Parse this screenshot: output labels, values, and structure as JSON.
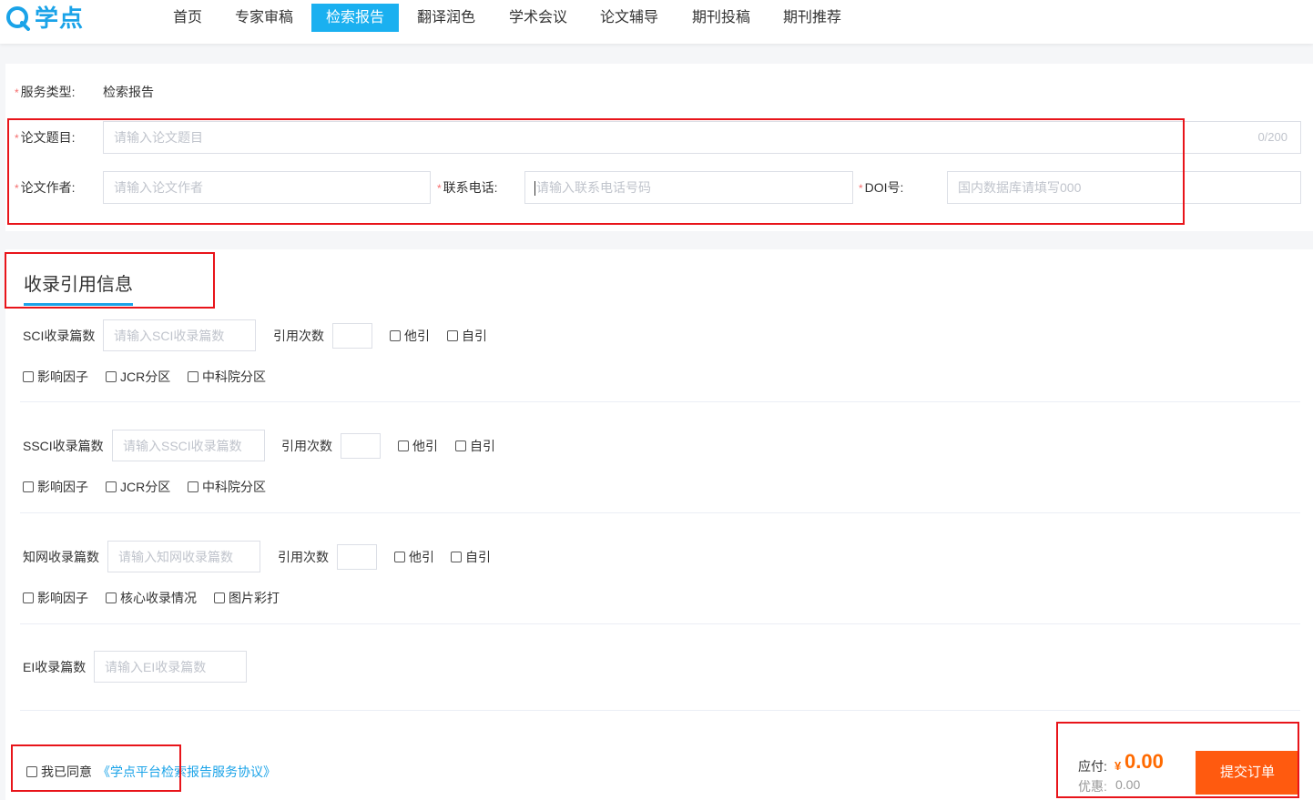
{
  "brand": {
    "name": "学点"
  },
  "nav": {
    "items": [
      {
        "label": "首页"
      },
      {
        "label": "专家审稿"
      },
      {
        "label": "检索报告"
      },
      {
        "label": "翻译润色"
      },
      {
        "label": "学术会议"
      },
      {
        "label": "论文辅导"
      },
      {
        "label": "期刊投稿"
      },
      {
        "label": "期刊推荐"
      }
    ],
    "active_index": 2
  },
  "form": {
    "required_mark": "*",
    "service_type_label": "服务类型:",
    "service_type_value": "检索报告",
    "title_label": "论文题目:",
    "title_placeholder": "请输入论文题目",
    "title_counter": "0/200",
    "author_label": "论文作者:",
    "author_placeholder": "请输入论文作者",
    "phone_label": "联系电话:",
    "phone_placeholder": "请输入联系电话号码",
    "doi_label": "DOI号:",
    "doi_placeholder": "国内数据库请填写000"
  },
  "citation": {
    "section_title": "收录引用信息",
    "groups": [
      {
        "label": "SCI收录篇数",
        "placeholder": "请输入SCI收录篇数",
        "cite_label": "引用次数",
        "cite_options": [
          "他引",
          "自引"
        ],
        "options": [
          "影响因子",
          "JCR分区",
          "中科院分区"
        ]
      },
      {
        "label": "SSCI收录篇数",
        "placeholder": "请输入SSCI收录篇数",
        "cite_label": "引用次数",
        "cite_options": [
          "他引",
          "自引"
        ],
        "options": [
          "影响因子",
          "JCR分区",
          "中科院分区"
        ]
      },
      {
        "label": "知网收录篇数",
        "placeholder": "请输入知网收录篇数",
        "cite_label": "引用次数",
        "cite_options": [
          "他引",
          "自引"
        ],
        "options": [
          "影响因子",
          "核心收录情况",
          "图片彩打"
        ]
      },
      {
        "label": "EI收录篇数",
        "placeholder": "请输入EI收录篇数"
      }
    ]
  },
  "agreement": {
    "prefix": "我已同意",
    "link": "《学点平台检索报告服务协议》"
  },
  "payment": {
    "payable_label": "应付:",
    "currency": "¥",
    "amount": "0.00",
    "discount_label": "优惠:",
    "discount": "0.00",
    "submit_label": "提交订单"
  },
  "colors": {
    "accent": "#1aa3e8",
    "nav_active": "#1ab0f0",
    "price": "#ff6a00",
    "submit": "#ff5a0f",
    "annotation": "#e8141a"
  }
}
